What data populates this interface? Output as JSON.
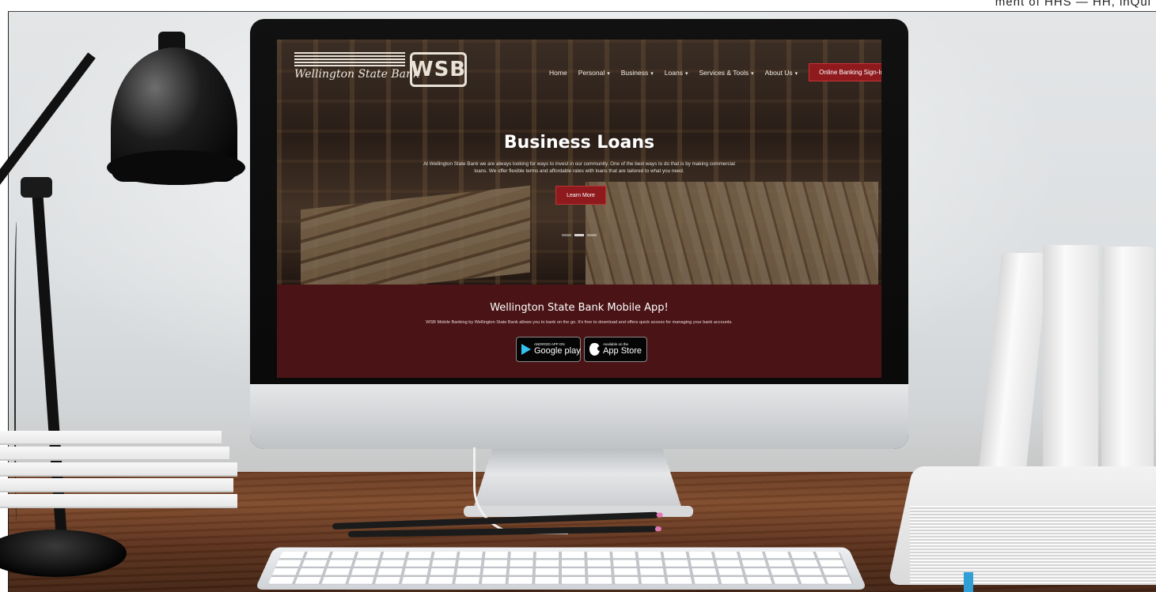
{
  "top_fragment": "ment of HHS — HH, inQui",
  "website": {
    "logo": {
      "script_text": "Wellington State Bank",
      "mark_text": "WSB"
    },
    "nav": [
      {
        "label": "Home",
        "has_dropdown": false
      },
      {
        "label": "Personal",
        "has_dropdown": true
      },
      {
        "label": "Business",
        "has_dropdown": true
      },
      {
        "label": "Loans",
        "has_dropdown": true
      },
      {
        "label": "Services & Tools",
        "has_dropdown": true
      },
      {
        "label": "About Us",
        "has_dropdown": true
      }
    ],
    "signin_label": "Online Banking Sign-In",
    "hero": {
      "title": "Business Loans",
      "text": "At Wellington State Bank we are always looking for ways to invest in our community. One of the best ways to do that is by making commercial loans. We offer flexible terms and affordable rates with loans that are tailored to what you need.",
      "button_label": "Learn More",
      "slides": 3,
      "active_slide": 2
    },
    "app_section": {
      "title": "Wellington State Bank Mobile App!",
      "text": "WSB Mobile Banking by Wellington State Bank allows you to bank on the go. It's free to download and offers quick access for managing your bank accounts.",
      "google_small": "ANDROID APP ON",
      "google_big": "Google play",
      "apple_small": "Available on the",
      "apple_big": "App Store"
    }
  },
  "colors": {
    "brand_red": "#8e1a1e",
    "app_section_bg": "#4a1416",
    "google_play_icon": "#35c2f0"
  },
  "icons": [
    "chevron-down-icon",
    "play-store-icon",
    "apple-icon"
  ]
}
